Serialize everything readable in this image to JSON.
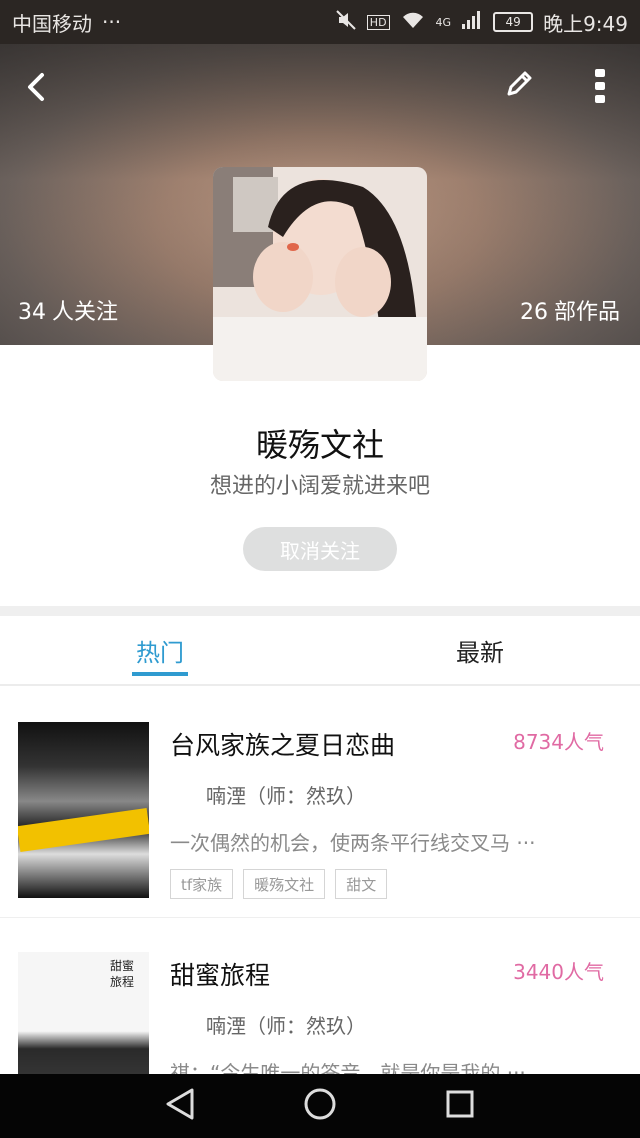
{
  "status_bar": {
    "carrier": "中国移动",
    "dots": "···",
    "network": "4G",
    "hd": "HD",
    "battery": "49",
    "time": "晚上9:49"
  },
  "header": {
    "following_count": "34",
    "following_label": "人关注",
    "works_count": "26",
    "works_label": "部作品"
  },
  "profile": {
    "name": "暖殇文社",
    "bio": "想进的小阔爱就进来吧",
    "unfollow_label": "取消关注"
  },
  "tabs": [
    {
      "label": "热门",
      "active": true
    },
    {
      "label": "最新",
      "active": false
    }
  ],
  "works": [
    {
      "title": "台风家族之夏日恋曲",
      "popularity": "8734人气",
      "author": "喃湮（师：然玖）",
      "description": "一次偶然的机会，使两条平行线交叉马 ···",
      "tags": [
        "tf家族",
        "暖殇文社",
        "甜文"
      ]
    },
    {
      "title": "甜蜜旅程",
      "popularity": "3440人气",
      "author": "喃湮（师：然玖）",
      "description": "祺：“今生唯一的答音，就是你是我的 ···",
      "cover_label": "甜蜜旅程",
      "tags": []
    }
  ],
  "colors": {
    "accent": "#2f9bd0",
    "popularity": "#e06aa3",
    "unfollow_bg": "#dedfdf"
  }
}
